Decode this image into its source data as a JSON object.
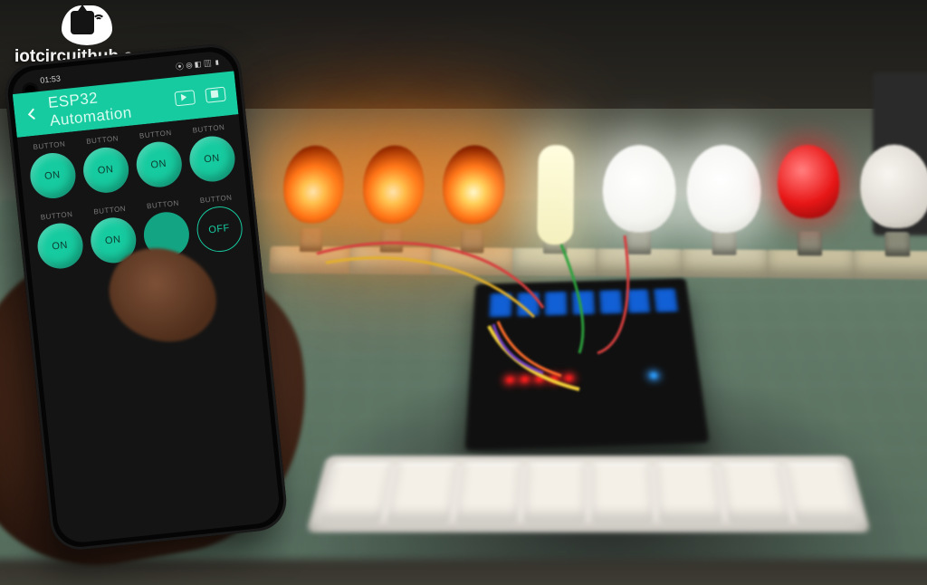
{
  "watermark": {
    "text": "iotcircuithub.com"
  },
  "phone": {
    "status": {
      "time": "01:53",
      "carrier_icons": "▸ ◂ ▣ ⬚ ⬚",
      "right_icons": "⦿ ⦾ ◧ ▥ ▮"
    },
    "appbar": {
      "title": "ESP32 Automation",
      "back_icon": "chevron-left-icon",
      "run_icon": "play-icon",
      "stop_icon": "stop-icon"
    },
    "widget_label": "BUTTON",
    "buttons": [
      {
        "state": "on",
        "label": "ON"
      },
      {
        "state": "on",
        "label": "ON"
      },
      {
        "state": "on",
        "label": "ON"
      },
      {
        "state": "on",
        "label": "ON"
      },
      {
        "state": "on",
        "label": "ON"
      },
      {
        "state": "on",
        "label": "ON"
      },
      {
        "state": "dim",
        "label": ""
      },
      {
        "state": "off",
        "label": "OFF"
      }
    ]
  },
  "colors": {
    "accent": "#1ec9a0",
    "screen_bg": "#141414"
  },
  "bulbs": [
    {
      "kind": "inc"
    },
    {
      "kind": "inc"
    },
    {
      "kind": "inc"
    },
    {
      "kind": "cfl"
    },
    {
      "kind": "led"
    },
    {
      "kind": "led"
    },
    {
      "kind": "redb"
    },
    {
      "kind": "offb"
    }
  ],
  "switch_count": 8
}
